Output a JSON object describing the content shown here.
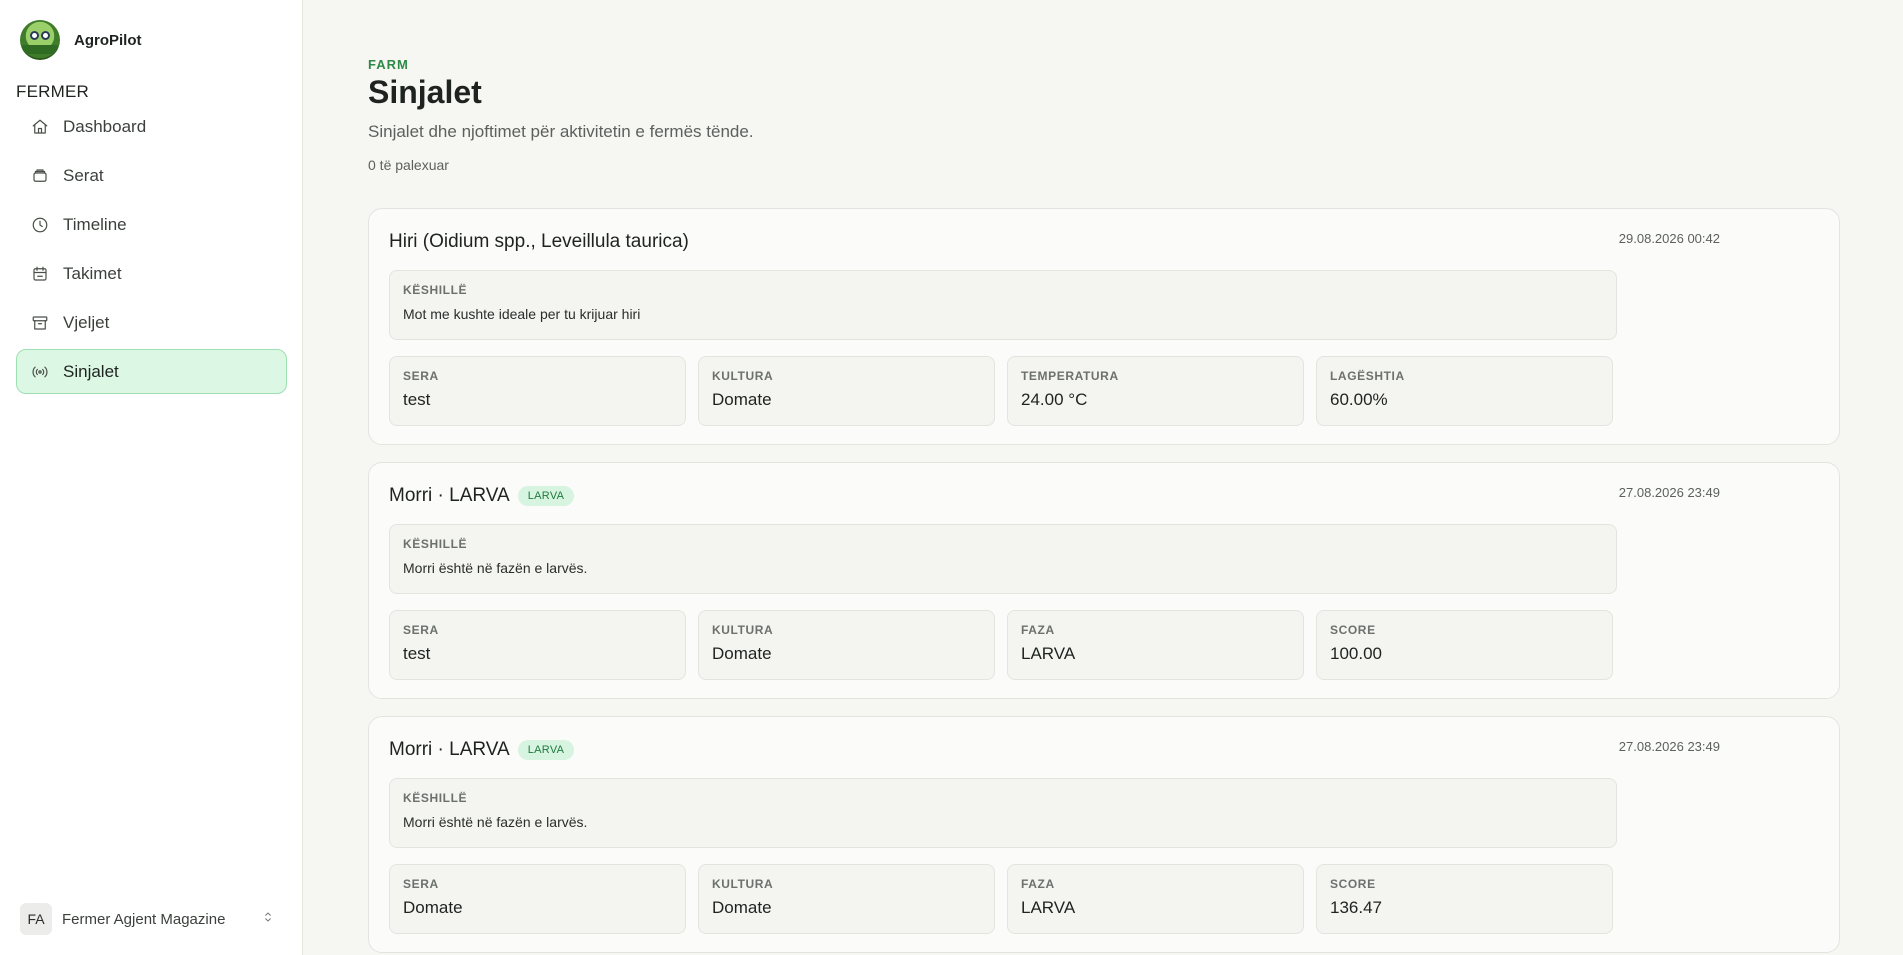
{
  "app": {
    "name": "AgroPilot",
    "logo_text": "Agro-Pilot"
  },
  "sidebar": {
    "section": "FERMER",
    "items": [
      {
        "label": "Dashboard",
        "icon": "home-icon"
      },
      {
        "label": "Serat",
        "icon": "layers-icon"
      },
      {
        "label": "Timeline",
        "icon": "clock-icon"
      },
      {
        "label": "Takimet",
        "icon": "calendar-icon"
      },
      {
        "label": "Vjeljet",
        "icon": "archive-icon"
      },
      {
        "label": "Sinjalet",
        "icon": "signal-icon",
        "active": true
      }
    ],
    "user": {
      "initials": "FA",
      "name": "Fermer Agjent Magazine"
    }
  },
  "header": {
    "eyebrow": "FARM",
    "title": "Sinjalet",
    "subtitle": "Sinjalet dhe njoftimet për aktivitetin e fermës tënde.",
    "unread": "0 të palexuar"
  },
  "signals": [
    {
      "title": "Hiri (Oidium spp., Leveillula taurica)",
      "tag": "",
      "time": "29.08.2026 00:42",
      "advice_label": "KËSHILLË",
      "advice": "Mot me kushte ideale per tu krijuar hiri",
      "metrics": [
        {
          "label": "SERA",
          "value": "test"
        },
        {
          "label": "KULTURA",
          "value": "Domate"
        },
        {
          "label": "TEMPERATURA",
          "value": "24.00 °C"
        },
        {
          "label": "LAGËSHTIA",
          "value": "60.00%"
        }
      ]
    },
    {
      "title": "Morri · LARVA",
      "tag": "LARVA",
      "time": "27.08.2026 23:49",
      "advice_label": "KËSHILLË",
      "advice": "Morri është në fazën e larvës.",
      "metrics": [
        {
          "label": "SERA",
          "value": "test"
        },
        {
          "label": "KULTURA",
          "value": "Domate"
        },
        {
          "label": "FAZA",
          "value": "LARVA"
        },
        {
          "label": "SCORE",
          "value": "100.00"
        }
      ]
    },
    {
      "title": "Morri · LARVA",
      "tag": "LARVA",
      "time": "27.08.2026 23:49",
      "advice_label": "KËSHILLË",
      "advice": "Morri është në fazën e larvës.",
      "metrics": [
        {
          "label": "SERA",
          "value": "Domate"
        },
        {
          "label": "KULTURA",
          "value": "Domate"
        },
        {
          "label": "FAZA",
          "value": "LARVA"
        },
        {
          "label": "SCORE",
          "value": "136.47"
        }
      ]
    }
  ]
}
